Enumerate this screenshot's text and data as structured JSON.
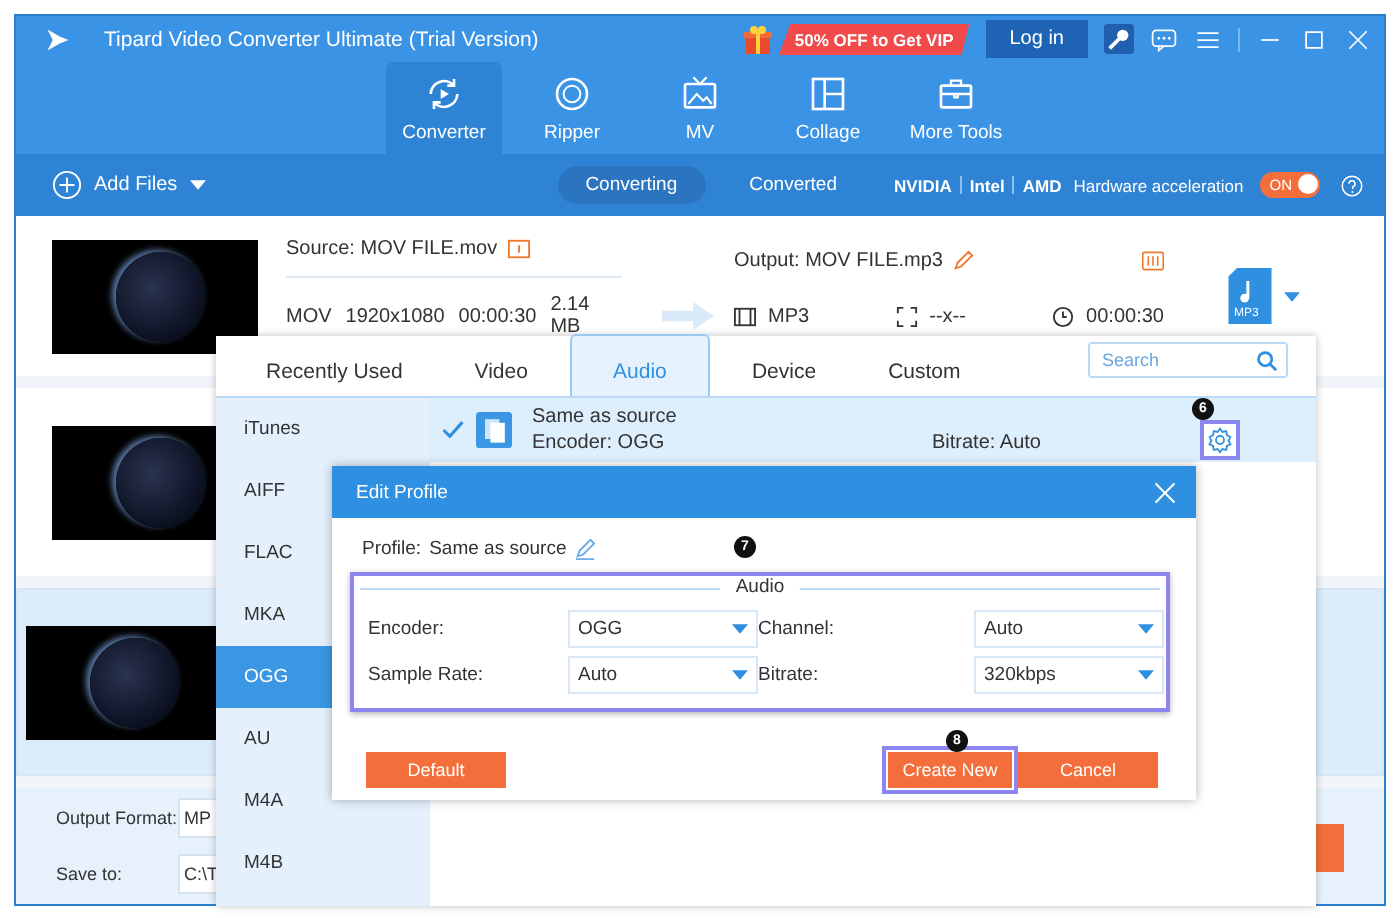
{
  "window": {
    "title": "Tipard Video Converter Ultimate (Trial Version)",
    "promo": "50% OFF to Get VIP",
    "login": "Log in"
  },
  "nav": [
    {
      "label": "Converter",
      "selected": true
    },
    {
      "label": "Ripper",
      "selected": false
    },
    {
      "label": "MV",
      "selected": false
    },
    {
      "label": "Collage",
      "selected": false
    },
    {
      "label": "More Tools",
      "selected": false
    }
  ],
  "toolbar": {
    "add_files": "Add Files",
    "tabs": [
      {
        "label": "Converting",
        "selected": true
      },
      {
        "label": "Converted",
        "selected": false
      }
    ],
    "gpus": [
      "NVIDIA",
      "Intel",
      "AMD"
    ],
    "hw_label": "Hardware acceleration",
    "hw_toggle": {
      "label": "ON",
      "on": true
    }
  },
  "files": [
    {
      "selected": false,
      "source": "Source: MOV FILE.mov",
      "output": "Output: MOV FILE.mp3",
      "meta": [
        "MOV",
        "1920x1080",
        "00:00:30",
        "2.14 MB"
      ],
      "out_format": "MP3",
      "out_size": "--x--",
      "out_duration": "00:00:30",
      "format_badge": "MP3"
    },
    {
      "selected": false
    },
    {
      "selected": true
    }
  ],
  "bottom": {
    "output_format_label": "Output Format:",
    "output_format": "MP",
    "save_label": "Save to:",
    "save_path": "C:\\T"
  },
  "format_panel": {
    "tabs": [
      {
        "label": "Recently Used",
        "selected": false
      },
      {
        "label": "Video",
        "selected": false
      },
      {
        "label": "Audio",
        "selected": true
      },
      {
        "label": "Device",
        "selected": false
      },
      {
        "label": "Custom",
        "selected": false
      }
    ],
    "search_placeholder": "Search",
    "categories": [
      {
        "label": "iTunes",
        "selected": false
      },
      {
        "label": "AIFF",
        "selected": false
      },
      {
        "label": "FLAC",
        "selected": false
      },
      {
        "label": "MKA",
        "selected": false
      },
      {
        "label": "OGG",
        "selected": true
      },
      {
        "label": "AU",
        "selected": false
      },
      {
        "label": "M4A",
        "selected": false
      },
      {
        "label": "M4B",
        "selected": false
      }
    ],
    "profile": {
      "name": "Same as source",
      "encoder": "Encoder: OGG",
      "bitrate": "Bitrate: Auto",
      "selected": true
    }
  },
  "dialog": {
    "title": "Edit Profile",
    "profile_label": "Profile:",
    "profile_name": "Same as source",
    "group": "Audio",
    "fields": [
      {
        "label": "Encoder:",
        "value": "OGG"
      },
      {
        "label": "Channel:",
        "value": "Auto"
      },
      {
        "label": "Sample Rate:",
        "value": "Auto"
      },
      {
        "label": "Bitrate:",
        "value": "320kbps"
      }
    ],
    "buttons": [
      {
        "label": "Default",
        "kind": "reset"
      },
      {
        "label": "Create New",
        "kind": "primary"
      },
      {
        "label": "Cancel",
        "kind": "cancel"
      }
    ]
  },
  "annotations": [
    "6",
    "7",
    "8"
  ]
}
